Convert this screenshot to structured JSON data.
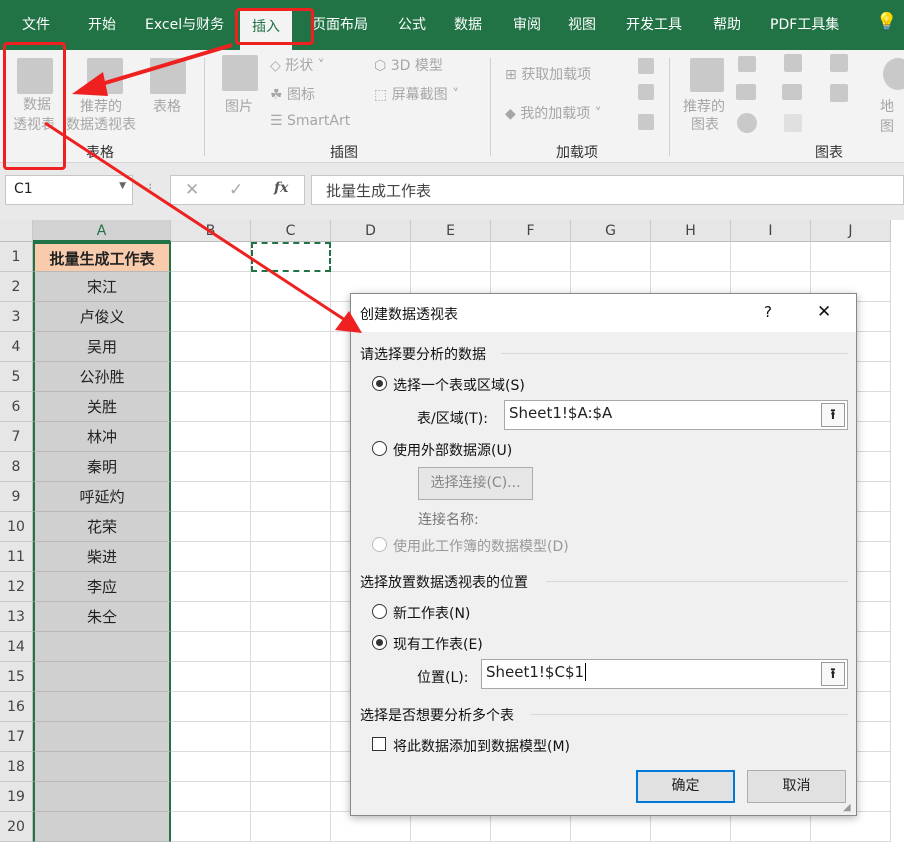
{
  "tabs": [
    "文件",
    "开始",
    "Excel与财务",
    "插入",
    "页面布局",
    "公式",
    "数据",
    "审阅",
    "视图",
    "开发工具",
    "帮助",
    "PDF工具集"
  ],
  "active_tab": "插入",
  "ribbon": {
    "tables": {
      "pivot": [
        "数据",
        "透视表"
      ],
      "recommended": [
        "推荐的",
        "数据透视表"
      ],
      "table": "表格",
      "group": "表格"
    },
    "illustrations": {
      "pictures": "图片",
      "shapes": "形状",
      "icons": "图标",
      "smartart": "SmartArt",
      "model3d": "3D 模型",
      "screenshot": "屏幕截图",
      "group": "插图"
    },
    "addins": {
      "get": "获取加载项",
      "my": "我的加载项",
      "group": "加载项"
    },
    "charts": {
      "recommended": [
        "推荐的",
        "图表"
      ],
      "group": "图表",
      "maps": "地图"
    }
  },
  "namebox": "C1",
  "formula": "批量生成工作表",
  "fx": "fx",
  "columns": [
    "A",
    "B",
    "C",
    "D",
    "E",
    "F",
    "G",
    "H",
    "I",
    "J"
  ],
  "rows": [
    "1",
    "2",
    "3",
    "4",
    "5",
    "6",
    "7",
    "8",
    "9",
    "10",
    "11",
    "12",
    "13",
    "14",
    "15",
    "16",
    "17",
    "18",
    "19",
    "20"
  ],
  "colA": [
    "批量生成工作表",
    "宋江",
    "卢俊义",
    "吴用",
    "公孙胜",
    "关胜",
    "林冲",
    "秦明",
    "呼延灼",
    "花荣",
    "柴进",
    "李应",
    "朱仝"
  ],
  "dialog": {
    "title": "创建数据透视表",
    "help": "?",
    "close": "✕",
    "sec1": "请选择要分析的数据",
    "opt_range": "选择一个表或区域(S)",
    "range_label": "表/区域(T):",
    "range_value": "Sheet1!$A:$A",
    "opt_external": "使用外部数据源(U)",
    "choose_conn": "选择连接(C)...",
    "conn_name": "连接名称:",
    "opt_model": "使用此工作簿的数据模型(D)",
    "sec2": "选择放置数据透视表的位置",
    "opt_new": "新工作表(N)",
    "opt_existing": "现有工作表(E)",
    "loc_label": "位置(L):",
    "loc_value": "Sheet1!$C$1",
    "sec3": "选择是否想要分析多个表",
    "add_model": "将此数据添加到数据模型(M)",
    "ok": "确定",
    "cancel": "取消",
    "picker": "⭱"
  }
}
